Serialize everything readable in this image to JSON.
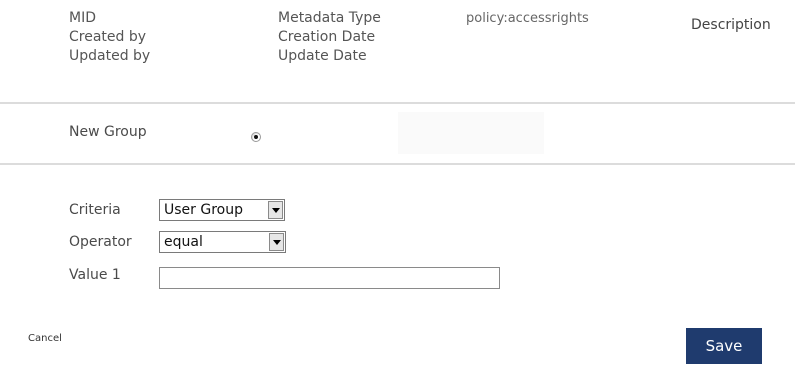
{
  "header": {
    "left_labels": [
      "MID",
      "Created by",
      "Updated by"
    ],
    "mid_labels": [
      "Metadata Type",
      "Creation Date",
      "Update Date"
    ],
    "metadata_type_value": "policy:accessrights",
    "description_label": "Description"
  },
  "group": {
    "label": "New Group",
    "radio_selected": true
  },
  "form": {
    "criteria_label": "Criteria",
    "criteria_value": "User Group",
    "operator_label": "Operator",
    "operator_value": "equal",
    "value1_label": "Value 1",
    "value1_value": ""
  },
  "actions": {
    "cancel_label": "Cancel",
    "save_label": "Save"
  },
  "colors": {
    "save_button_bg": "#1f3b6e",
    "divider": "#dcdcdc"
  }
}
